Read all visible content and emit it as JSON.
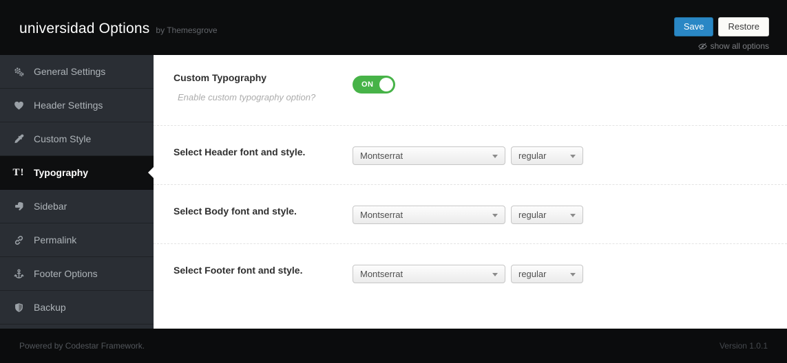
{
  "header": {
    "title": "universidad Options",
    "byline": "by Themesgrove",
    "save_label": "Save",
    "restore_label": "Restore",
    "show_all_label": "show all options"
  },
  "sidebar": {
    "items": [
      {
        "label": "General Settings",
        "icon": "gears-icon"
      },
      {
        "label": "Header Settings",
        "icon": "heart-icon"
      },
      {
        "label": "Custom Style",
        "icon": "eyedropper-icon"
      },
      {
        "label": "Typography",
        "icon": "typography-icon",
        "active": true
      },
      {
        "label": "Sidebar",
        "icon": "hand-pointer-icon"
      },
      {
        "label": "Permalink",
        "icon": "link-icon"
      },
      {
        "label": "Footer Options",
        "icon": "anchor-icon"
      },
      {
        "label": "Backup",
        "icon": "shield-icon"
      }
    ]
  },
  "content": {
    "toggle_row": {
      "label": "Custom Typography",
      "description": "Enable custom typography option?",
      "toggle_state": "ON"
    },
    "font_rows": [
      {
        "label": "Select Header font and style.",
        "font": "Montserrat",
        "style": "regular"
      },
      {
        "label": "Select Body font and style.",
        "font": "Montserrat",
        "style": "regular"
      },
      {
        "label": "Select Footer font and style.",
        "font": "Montserrat",
        "style": "regular"
      }
    ]
  },
  "footer": {
    "powered_by": "Powered by Codestar Framework.",
    "version": "Version 1.0.1"
  },
  "colors": {
    "topbar_bg": "#0c0d0e",
    "sidebar_bg": "#2a2e34",
    "save_blue": "#2a87c5",
    "toggle_green": "#47b348"
  }
}
